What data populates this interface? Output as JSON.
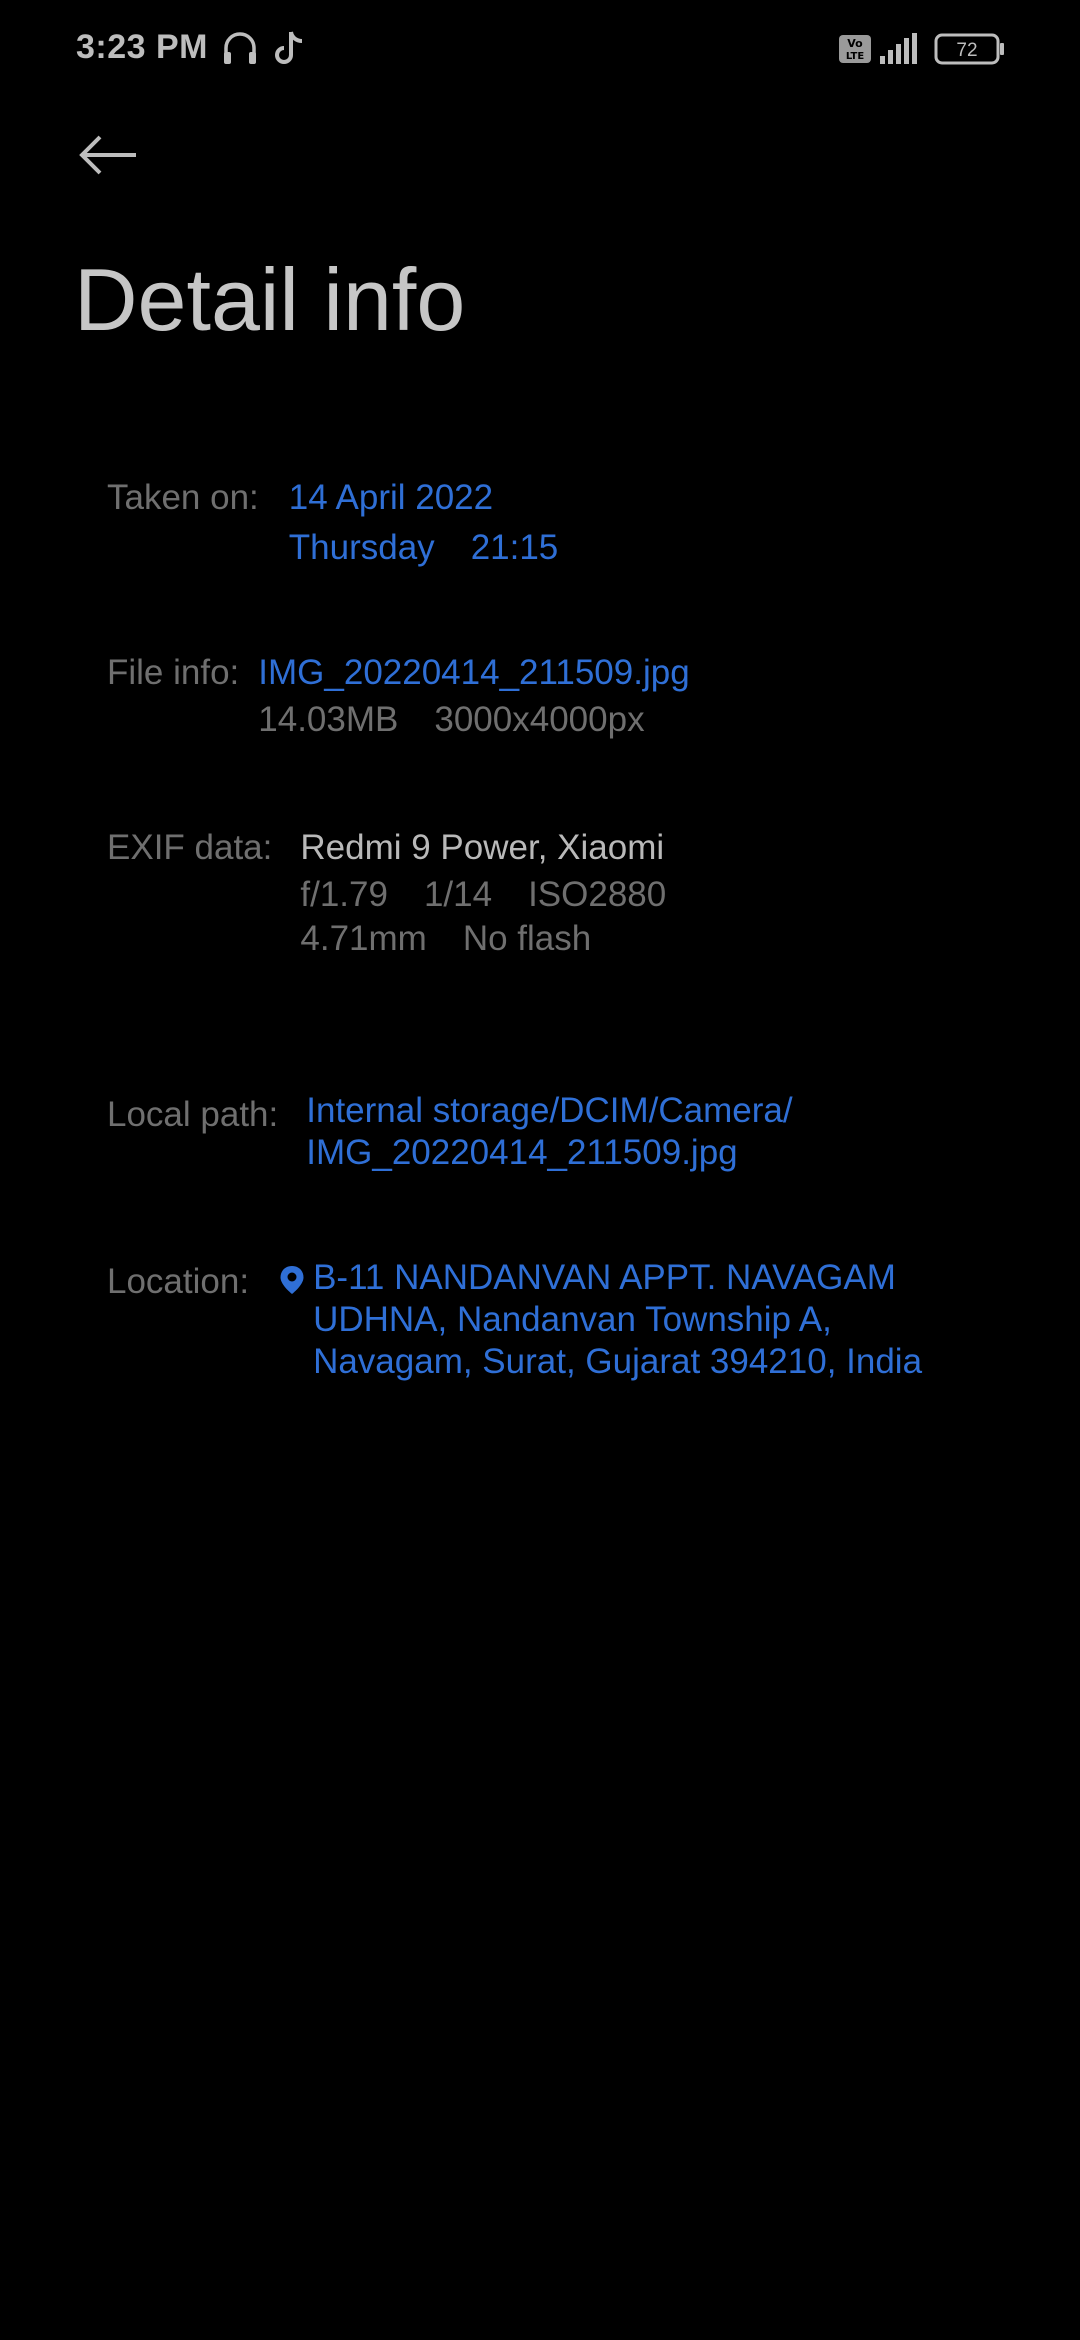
{
  "status_bar": {
    "time": "3:23 PM",
    "battery_level": "72",
    "icons": [
      "headphones-icon",
      "tiktok-icon",
      "volte-icon",
      "signal-icon",
      "battery-icon"
    ]
  },
  "header": {
    "back_icon": "arrow-left-icon",
    "title": "Detail info"
  },
  "details": {
    "taken_on": {
      "label": "Taken on:",
      "date": "14 April 2022",
      "day": "Thursday",
      "time": "21:15"
    },
    "file_info": {
      "label": "File info:",
      "file_name": "IMG_20220414_211509.jpg",
      "size": "14.03MB",
      "resolution": "3000x4000px"
    },
    "exif_data": {
      "label": "EXIF data:",
      "device": "Redmi 9 Power, Xiaomi",
      "aperture": "f/1.79",
      "shutter": "1/14",
      "iso": "ISO2880",
      "focal_length": "4.71mm",
      "flash": "No flash"
    },
    "local_path": {
      "label": "Local path:",
      "line1": "Internal storage/DCIM/Camera/",
      "line2": "IMG_20220414_211509.jpg"
    },
    "location": {
      "label": "Location:",
      "icon": "location-pin-icon",
      "line1": "B-11 NANDANVAN APPT. NAVAGAM",
      "line2": "UDHNA, Nandanvan Township A,",
      "line3": "Navagam, Surat, Gujarat 394210, India"
    }
  },
  "colors": {
    "background": "#000000",
    "link": "#2f6fd6",
    "label": "#6f6f6f",
    "text": "#b9b9b9",
    "title": "#c6c6c6"
  }
}
